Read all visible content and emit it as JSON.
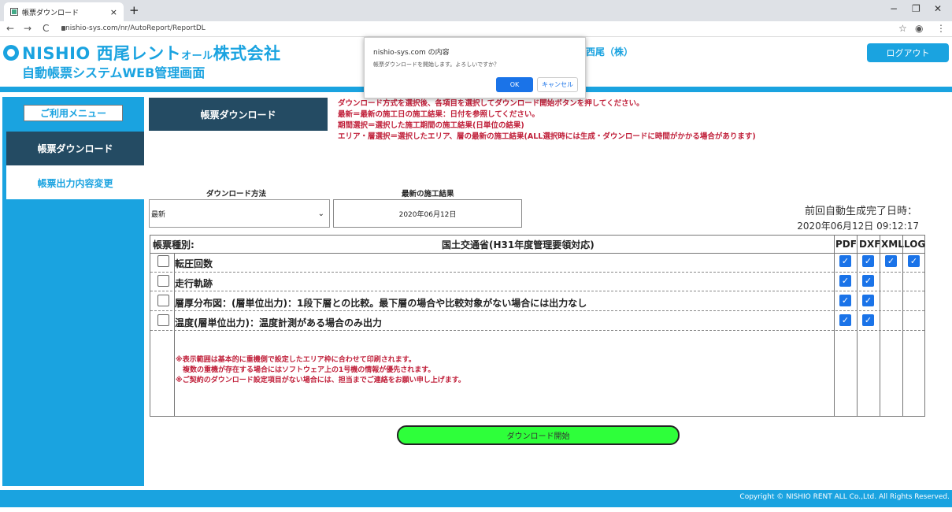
{
  "browser": {
    "tab_title": "帳票ダウンロード",
    "tab_close": "×",
    "new_tab": "+",
    "url": "nishio-sys.com/nr/AutoReport/ReportDL",
    "minimize": "−",
    "restore": "❐",
    "close": "✕",
    "back": "←",
    "forward": "→",
    "reload": "C",
    "star": "☆",
    "profile": "◉",
    "more": "⋮"
  },
  "header": {
    "logo_brand": "NISHIO",
    "logo_name1": "西尾レント",
    "logo_small": "オール",
    "logo_name2": "株式会社",
    "system_name": "自動帳票システムWEB管理画面",
    "company": "西尾（株）",
    "logout": "ログアウト"
  },
  "sidebar": {
    "menu_title": "ご利用メニュー",
    "items": [
      {
        "label": "帳票ダウンロード",
        "active": true
      },
      {
        "label": "帳票出力内容変更",
        "active": false
      }
    ]
  },
  "main": {
    "page_title": "帳票ダウンロード",
    "instructions": [
      "ダウンロード方式を選択後、各項目を選択してダウンロード開始ボタンを押してください。",
      "最新＝最新の施工日の施工結果：日付を参照してください。",
      "期間選択＝選択した施工期間の施工結果(日単位の結果)",
      "エリア・層選択＝選択したエリア、層の最新の施工結果(ALL選択時には生成・ダウンロードに時間がかかる場合があります)"
    ],
    "method_label": "ダウンロード方法",
    "latest_label": "最新の施工結果",
    "method_value": "最新",
    "latest_value": "2020年06月12日",
    "prev_label": "前回自動生成完了日時：",
    "prev_value": "2020年06月12日 09:12:17",
    "table": {
      "kind_label": "帳票種別:",
      "standard": "国土交通省(H31年度管理要領対応)",
      "columns": [
        "PDF",
        "DXF",
        "XML",
        "LOG"
      ],
      "rows": [
        {
          "label": "転圧回数",
          "checked": false,
          "formats": [
            true,
            true,
            true,
            true
          ]
        },
        {
          "label": "走行軌跡",
          "checked": false,
          "formats": [
            true,
            true,
            null,
            null
          ]
        },
        {
          "label": "層厚分布図：(層単位出力)：1段下層との比較。最下層の場合や比較対象がない場合には出力なし",
          "checked": false,
          "formats": [
            true,
            true,
            null,
            null
          ]
        },
        {
          "label": "温度(層単位出力)：温度計測がある場合のみ出力",
          "checked": false,
          "formats": [
            true,
            true,
            null,
            null
          ]
        }
      ],
      "notes": [
        "※表示範囲は基本的に重機側で設定したエリア枠に合わせて印刷されます。",
        "　複数の重機が存在する場合にはソフトウェア上の1号機の情報が優先されます。",
        "※ご契約のダウンロード設定項目がない場合には、担当までご連絡をお願い申し上げます。"
      ]
    },
    "download_button": "ダウンロード開始"
  },
  "footer": {
    "copyright": "Copyright © NISHIO RENT ALL Co.,Ltd. All Rights Reserved."
  },
  "dialog": {
    "title": "nishio-sys.com の内容",
    "message": "帳票ダウンロードを開始します。よろしいですか？",
    "ok": "OK",
    "cancel": "キャンセル"
  },
  "colors": {
    "brand": "#1aa3e0",
    "nav_dark": "#244b63",
    "alert_text": "#c0203a",
    "download_button": "#2eff3a",
    "checkbox": "#1a73e8"
  }
}
